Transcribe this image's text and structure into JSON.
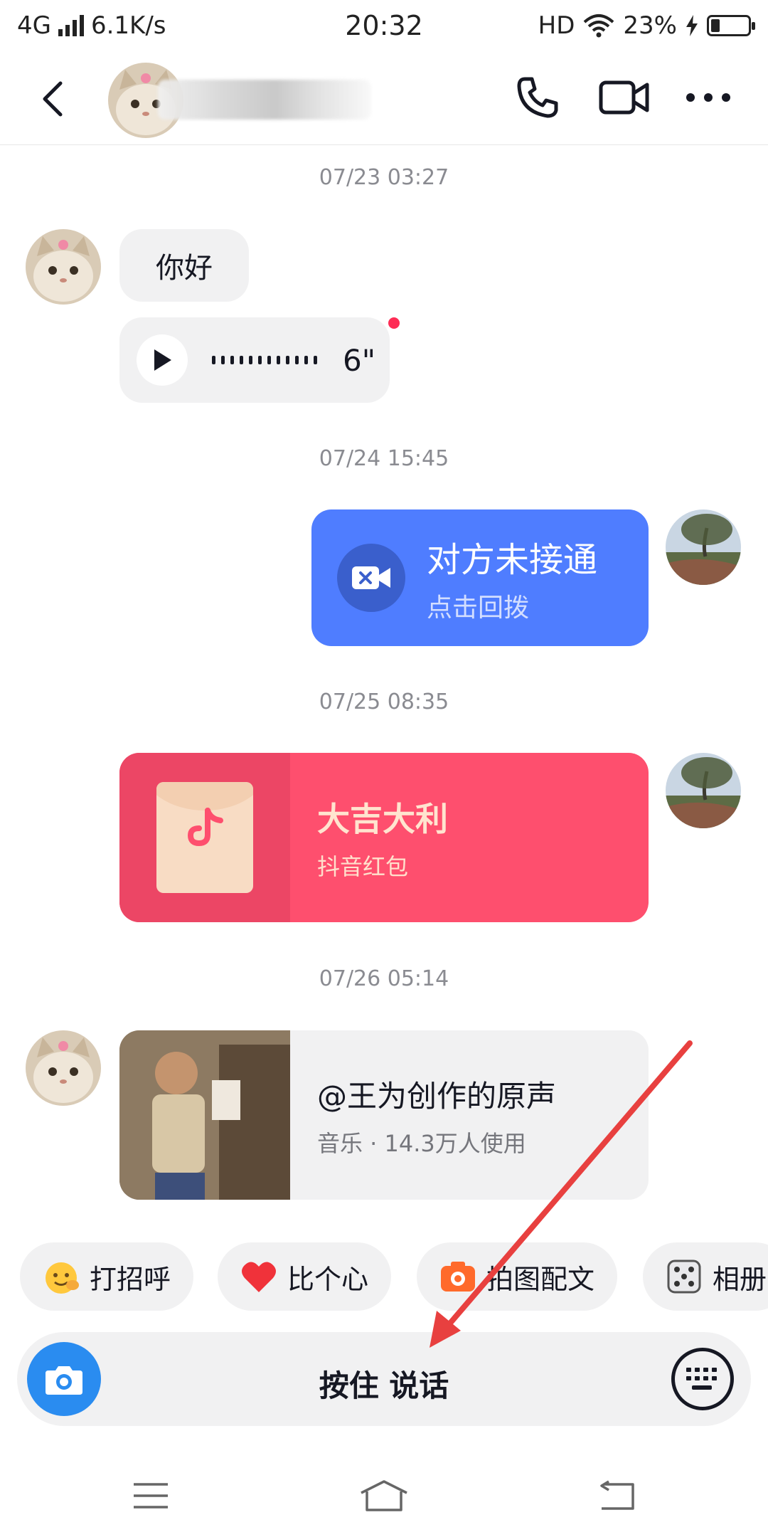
{
  "status_bar": {
    "network": "4G",
    "speed": "6.1K/s",
    "time": "20:32",
    "hd": "HD",
    "battery": "23%",
    "battery_level": 0.23
  },
  "header": {
    "back_icon": "chevron-left-icon",
    "call_icon": "phone-icon",
    "video_icon": "video-camera-icon",
    "more_icon": "more-dots-icon"
  },
  "messages": [
    {
      "timestamp": "07/23 03:27"
    },
    {
      "text": "你好"
    },
    {
      "voice_duration": "6\""
    },
    {
      "timestamp": "07/24 15:45"
    },
    {
      "call_title": "对方未接通",
      "call_sub": "点击回拨"
    },
    {
      "timestamp": "07/25 08:35"
    },
    {
      "red_title": "大吉大利",
      "red_sub": "抖音红包"
    },
    {
      "timestamp": "07/26 05:14"
    },
    {
      "music_title": "@王为创作的原声",
      "music_sub": "音乐 · 14.3万人使用"
    }
  ],
  "chips": [
    {
      "label": "打招呼",
      "icon": "wave-hand-icon"
    },
    {
      "label": "比个心",
      "icon": "heart-icon"
    },
    {
      "label": "拍图配文",
      "icon": "camera-icon"
    },
    {
      "label": "相册",
      "icon": "dice-icon"
    }
  ],
  "input": {
    "hold_to_talk": "按住 说话"
  },
  "colors": {
    "call_card": "#4f7dff",
    "red_packet": "#fe4f6e",
    "camera_button": "#2a8cf0",
    "arrow": "#e8403f"
  }
}
